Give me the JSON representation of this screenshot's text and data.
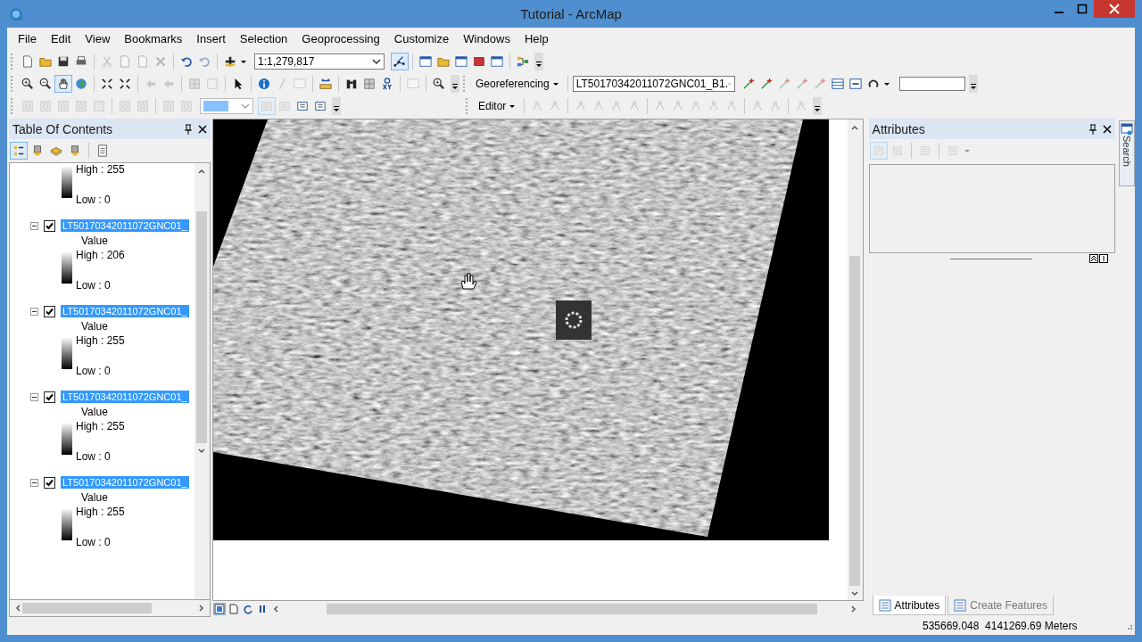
{
  "window": {
    "title": "Tutorial - ArcMap"
  },
  "menu": [
    "File",
    "Edit",
    "View",
    "Bookmarks",
    "Insert",
    "Selection",
    "Geoprocessing",
    "Customize",
    "Windows",
    "Help"
  ],
  "standard_toolbar": {
    "scale": "1:1,279,817"
  },
  "georeferencing_toolbar": {
    "menu": "Georeferencing",
    "layer": "LT50170342011072GNC01_B1."
  },
  "editor_toolbar": {
    "menu": "Editor"
  },
  "toc": {
    "title": "Table Of Contents",
    "legend_top": {
      "high": "High : 255",
      "low": "Low : 0"
    },
    "layers": [
      {
        "name": "LT50170342011072GNC01_",
        "checked": true,
        "expanded": true,
        "selected": true,
        "field": "Value",
        "high": "High : 206",
        "low": "Low : 0"
      },
      {
        "name": "LT50170342011072GNC01_",
        "checked": true,
        "expanded": true,
        "selected": true,
        "field": "Value",
        "high": "High : 255",
        "low": "Low : 0"
      },
      {
        "name": "LT50170342011072GNC01_",
        "checked": true,
        "expanded": true,
        "selected": true,
        "field": "Value",
        "high": "High : 255",
        "low": "Low : 0"
      },
      {
        "name": "LT50170342011072GNC01_",
        "checked": true,
        "expanded": true,
        "selected": true,
        "field": "Value",
        "high": "High : 255",
        "low": "Low : 0"
      }
    ]
  },
  "attributes": {
    "title": "Attributes"
  },
  "side_tab": "Search",
  "bottom_tabs": [
    {
      "label": "Attributes",
      "selected": true
    },
    {
      "label": "Create Features",
      "selected": false
    }
  ],
  "status_bar": {
    "coordinates": "535669.048  4141269.69 Meters"
  }
}
